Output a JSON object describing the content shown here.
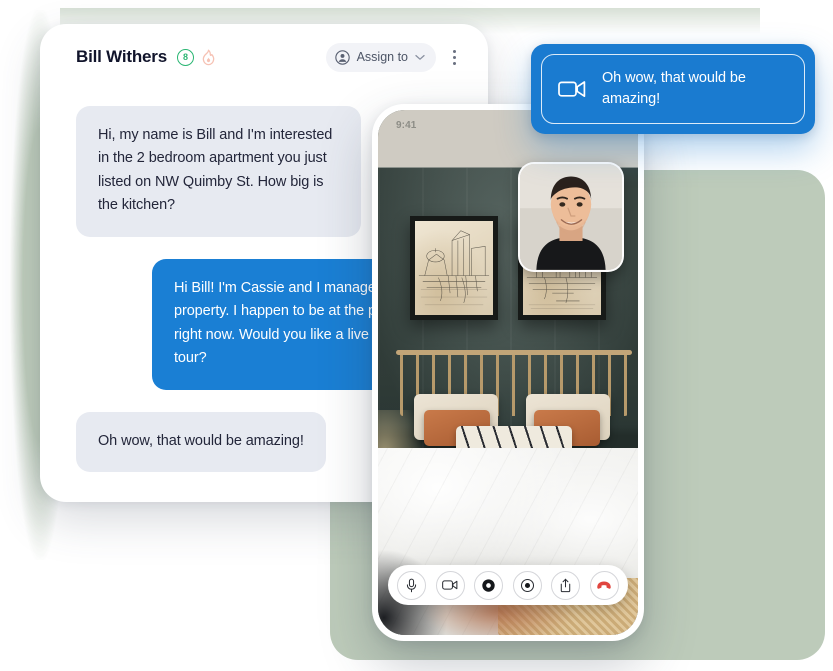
{
  "inbox": {
    "contact_name": "Bill Withers",
    "badges": {
      "count_label": "8",
      "count_icon": "circle-count-badge",
      "flame_icon": "flame-icon"
    },
    "assign_button": {
      "label": "Assign to",
      "person_icon": "person-circle-icon",
      "chevron_icon": "chevron-down-icon"
    },
    "more_menu_icon": "kebab-menu-icon",
    "messages": [
      {
        "direction": "in",
        "text": "Hi, my name is Bill and I'm interested in the 2 bedroom apartment you just listed on NW Quimby St. How big is the kitchen?"
      },
      {
        "direction": "out",
        "text": "Hi Bill! I'm Cassie and I manage the property. I happen to be at the property right now. Would you like a live video tour?"
      },
      {
        "direction": "in",
        "text": "Oh wow, that would be amazing!"
      }
    ]
  },
  "phone": {
    "status_time": "9:41",
    "self_view": {
      "name": "self-view-video-tile"
    },
    "scene": {
      "name": "property-video-bedroom"
    },
    "call_controls": [
      {
        "name": "microphone-icon",
        "label": "Microphone"
      },
      {
        "name": "video-camera-icon",
        "label": "Camera"
      },
      {
        "name": "record-icon",
        "label": "Record"
      },
      {
        "name": "capture-icon",
        "label": "Capture"
      },
      {
        "name": "share-icon",
        "label": "Share"
      },
      {
        "name": "end-call-icon",
        "label": "End call"
      }
    ]
  },
  "toast": {
    "icon": "video-camera-icon",
    "text": "Oh wow, that would be\namazing!"
  },
  "colors": {
    "brand_blue": "#1a7fd4",
    "toast_blue": "#1a7bd0",
    "bubble_grey": "#e7eaf1",
    "text_dark": "#23263a",
    "badge_green": "#2bb673",
    "flame_pink": "#f6c2b4",
    "backdrop_green": "#b7c7b4",
    "end_call_red": "#e0453f"
  }
}
